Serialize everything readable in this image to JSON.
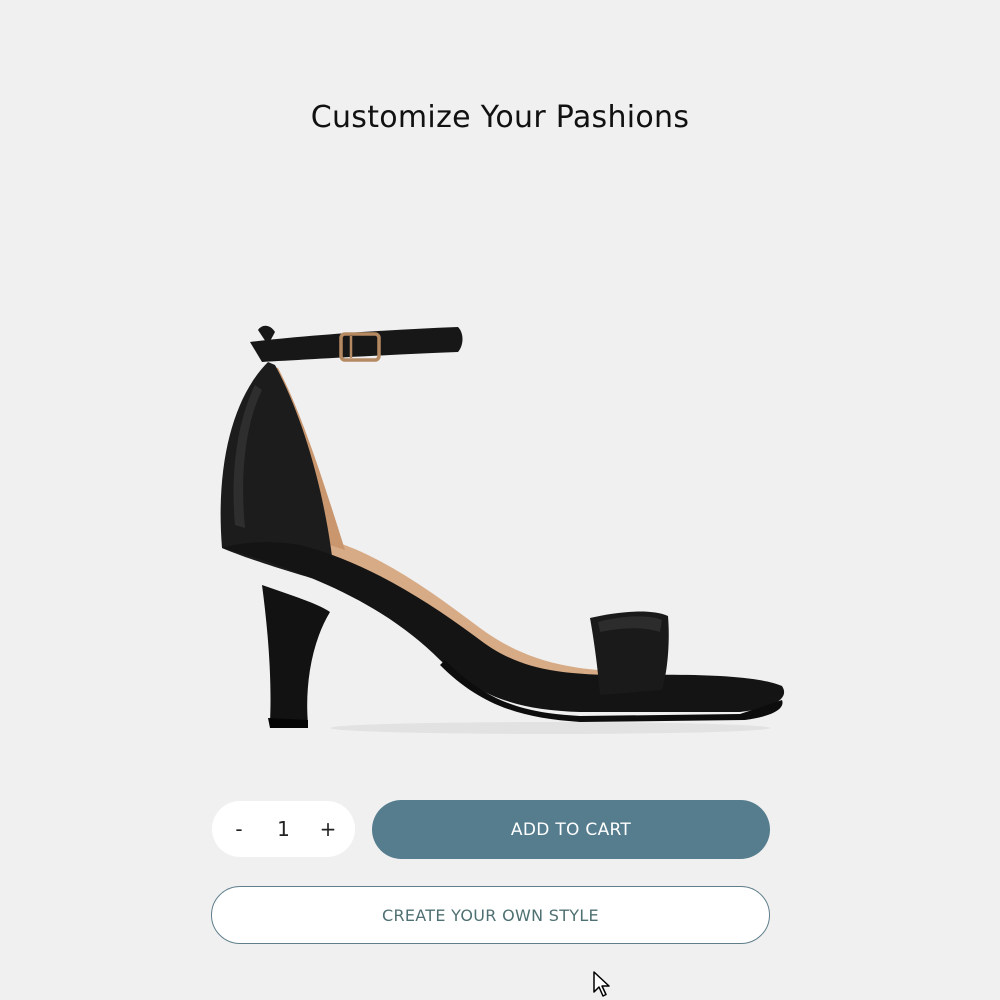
{
  "page": {
    "title": "Customize Your Pashions"
  },
  "product": {
    "image_icon": "black-ankle-strap-heeled-sandal"
  },
  "quantity": {
    "decrement_label": "-",
    "value": "1",
    "increment_label": "+"
  },
  "actions": {
    "add_to_cart_label": "ADD TO CART",
    "create_style_label": "CREATE YOUR OWN STYLE"
  },
  "colors": {
    "background": "#f0f0f0",
    "primary_button": "#557d8e",
    "outline_button_border": "#5f7f8b",
    "outline_button_text": "#4f7072"
  },
  "pointer": {
    "icon": "mouse-pointer-icon"
  }
}
